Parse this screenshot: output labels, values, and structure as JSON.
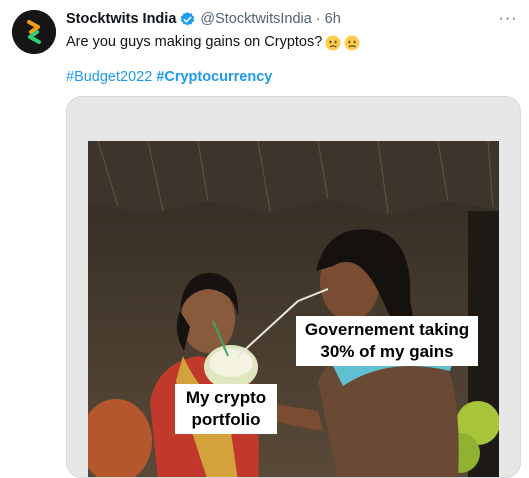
{
  "author": {
    "name": "Stocktwits India",
    "handle": "@StocktwitsIndia",
    "separator": "·",
    "time": "6h"
  },
  "tweet": {
    "text": "Are you guys making gains on Cryptos?",
    "emoji_icons": [
      "worried-face-icon",
      "worried-face-icon"
    ],
    "hashtags": [
      "#Budget2022",
      "#Cryptocurrency"
    ]
  },
  "more_label": "···",
  "meme": {
    "caption_government": "Governement taking 30% of my gains",
    "caption_crypto": "My crypto portfolio"
  },
  "colors": {
    "link": "#1d9bf0",
    "verified": "#1d9bf0",
    "secondary_text": "#536471"
  }
}
